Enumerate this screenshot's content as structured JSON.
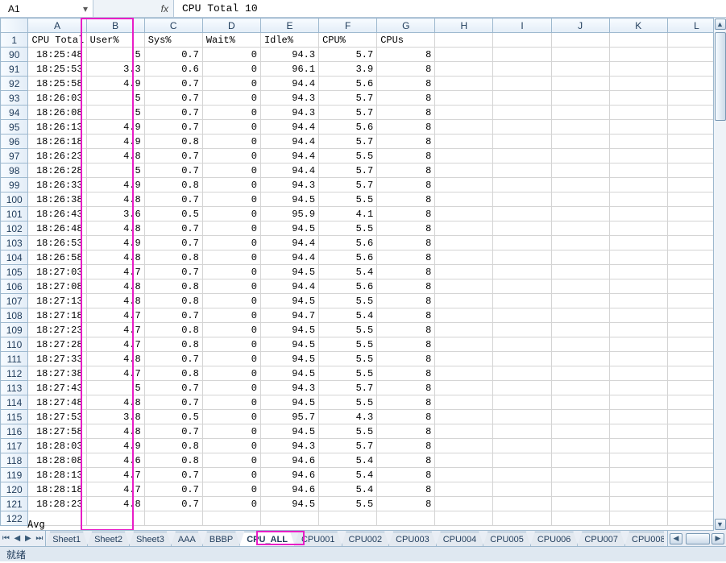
{
  "name_box": "A1",
  "fx_label": "fx",
  "formula": "CPU Total 10",
  "columns": [
    "A",
    "B",
    "C",
    "D",
    "E",
    "F",
    "G",
    "H",
    "I",
    "J",
    "K",
    "L"
  ],
  "header_row_num": "1",
  "headers": {
    "A": "CPU Total",
    "B": "User%",
    "C": "Sys%",
    "D": "Wait%",
    "E": "Idle%",
    "F": "CPU%",
    "G": "CPUs"
  },
  "row_nums": [
    90,
    91,
    92,
    93,
    94,
    95,
    96,
    97,
    98,
    99,
    100,
    101,
    102,
    103,
    104,
    105,
    106,
    107,
    108,
    109,
    110,
    111,
    112,
    113,
    114,
    115,
    116,
    117,
    118,
    119,
    120,
    121,
    122
  ],
  "rows": [
    {
      "time": "18:25:48",
      "user": "5",
      "sys": "0.7",
      "wait": "0",
      "idle": "94.3",
      "cpu": "5.7",
      "cpus": "8"
    },
    {
      "time": "18:25:53",
      "user": "3.3",
      "sys": "0.6",
      "wait": "0",
      "idle": "96.1",
      "cpu": "3.9",
      "cpus": "8"
    },
    {
      "time": "18:25:58",
      "user": "4.9",
      "sys": "0.7",
      "wait": "0",
      "idle": "94.4",
      "cpu": "5.6",
      "cpus": "8"
    },
    {
      "time": "18:26:03",
      "user": "5",
      "sys": "0.7",
      "wait": "0",
      "idle": "94.3",
      "cpu": "5.7",
      "cpus": "8"
    },
    {
      "time": "18:26:08",
      "user": "5",
      "sys": "0.7",
      "wait": "0",
      "idle": "94.3",
      "cpu": "5.7",
      "cpus": "8"
    },
    {
      "time": "18:26:13",
      "user": "4.9",
      "sys": "0.7",
      "wait": "0",
      "idle": "94.4",
      "cpu": "5.6",
      "cpus": "8"
    },
    {
      "time": "18:26:18",
      "user": "4.9",
      "sys": "0.8",
      "wait": "0",
      "idle": "94.4",
      "cpu": "5.7",
      "cpus": "8"
    },
    {
      "time": "18:26:23",
      "user": "4.8",
      "sys": "0.7",
      "wait": "0",
      "idle": "94.4",
      "cpu": "5.5",
      "cpus": "8"
    },
    {
      "time": "18:26:28",
      "user": "5",
      "sys": "0.7",
      "wait": "0",
      "idle": "94.4",
      "cpu": "5.7",
      "cpus": "8"
    },
    {
      "time": "18:26:33",
      "user": "4.9",
      "sys": "0.8",
      "wait": "0",
      "idle": "94.3",
      "cpu": "5.7",
      "cpus": "8"
    },
    {
      "time": "18:26:38",
      "user": "4.8",
      "sys": "0.7",
      "wait": "0",
      "idle": "94.5",
      "cpu": "5.5",
      "cpus": "8"
    },
    {
      "time": "18:26:43",
      "user": "3.6",
      "sys": "0.5",
      "wait": "0",
      "idle": "95.9",
      "cpu": "4.1",
      "cpus": "8"
    },
    {
      "time": "18:26:48",
      "user": "4.8",
      "sys": "0.7",
      "wait": "0",
      "idle": "94.5",
      "cpu": "5.5",
      "cpus": "8"
    },
    {
      "time": "18:26:53",
      "user": "4.9",
      "sys": "0.7",
      "wait": "0",
      "idle": "94.4",
      "cpu": "5.6",
      "cpus": "8"
    },
    {
      "time": "18:26:58",
      "user": "4.8",
      "sys": "0.8",
      "wait": "0",
      "idle": "94.4",
      "cpu": "5.6",
      "cpus": "8"
    },
    {
      "time": "18:27:03",
      "user": "4.7",
      "sys": "0.7",
      "wait": "0",
      "idle": "94.5",
      "cpu": "5.4",
      "cpus": "8"
    },
    {
      "time": "18:27:08",
      "user": "4.8",
      "sys": "0.8",
      "wait": "0",
      "idle": "94.4",
      "cpu": "5.6",
      "cpus": "8"
    },
    {
      "time": "18:27:13",
      "user": "4.8",
      "sys": "0.8",
      "wait": "0",
      "idle": "94.5",
      "cpu": "5.5",
      "cpus": "8"
    },
    {
      "time": "18:27:18",
      "user": "4.7",
      "sys": "0.7",
      "wait": "0",
      "idle": "94.7",
      "cpu": "5.4",
      "cpus": "8"
    },
    {
      "time": "18:27:23",
      "user": "4.7",
      "sys": "0.8",
      "wait": "0",
      "idle": "94.5",
      "cpu": "5.5",
      "cpus": "8"
    },
    {
      "time": "18:27:28",
      "user": "4.7",
      "sys": "0.8",
      "wait": "0",
      "idle": "94.5",
      "cpu": "5.5",
      "cpus": "8"
    },
    {
      "time": "18:27:33",
      "user": "4.8",
      "sys": "0.7",
      "wait": "0",
      "idle": "94.5",
      "cpu": "5.5",
      "cpus": "8"
    },
    {
      "time": "18:27:38",
      "user": "4.7",
      "sys": "0.8",
      "wait": "0",
      "idle": "94.5",
      "cpu": "5.5",
      "cpus": "8"
    },
    {
      "time": "18:27:43",
      "user": "5",
      "sys": "0.7",
      "wait": "0",
      "idle": "94.3",
      "cpu": "5.7",
      "cpus": "8"
    },
    {
      "time": "18:27:48",
      "user": "4.8",
      "sys": "0.7",
      "wait": "0",
      "idle": "94.5",
      "cpu": "5.5",
      "cpus": "8"
    },
    {
      "time": "18:27:53",
      "user": "3.8",
      "sys": "0.5",
      "wait": "0",
      "idle": "95.7",
      "cpu": "4.3",
      "cpus": "8"
    },
    {
      "time": "18:27:58",
      "user": "4.8",
      "sys": "0.7",
      "wait": "0",
      "idle": "94.5",
      "cpu": "5.5",
      "cpus": "8"
    },
    {
      "time": "18:28:03",
      "user": "4.9",
      "sys": "0.8",
      "wait": "0",
      "idle": "94.3",
      "cpu": "5.7",
      "cpus": "8"
    },
    {
      "time": "18:28:08",
      "user": "4.6",
      "sys": "0.8",
      "wait": "0",
      "idle": "94.6",
      "cpu": "5.4",
      "cpus": "8"
    },
    {
      "time": "18:28:13",
      "user": "4.7",
      "sys": "0.7",
      "wait": "0",
      "idle": "94.6",
      "cpu": "5.4",
      "cpus": "8"
    },
    {
      "time": "18:28:18",
      "user": "4.7",
      "sys": "0.7",
      "wait": "0",
      "idle": "94.6",
      "cpu": "5.4",
      "cpus": "8"
    },
    {
      "time": "18:28:23",
      "user": "4.8",
      "sys": "0.7",
      "wait": "0",
      "idle": "94.5",
      "cpu": "5.5",
      "cpus": "8"
    },
    {
      "time": "",
      "user": "",
      "sys": "",
      "wait": "",
      "idle": "",
      "cpu": "",
      "cpus": ""
    }
  ],
  "partial_row_text": "Avg",
  "sheet_tabs": [
    "Sheet1",
    "Sheet2",
    "Sheet3",
    "AAA",
    "BBBP",
    "CPU_ALL",
    "CPU001",
    "CPU002",
    "CPU003",
    "CPU004",
    "CPU005",
    "CPU006",
    "CPU007",
    "CPU008"
  ],
  "active_tab_index": 5,
  "status_text": "就绪"
}
